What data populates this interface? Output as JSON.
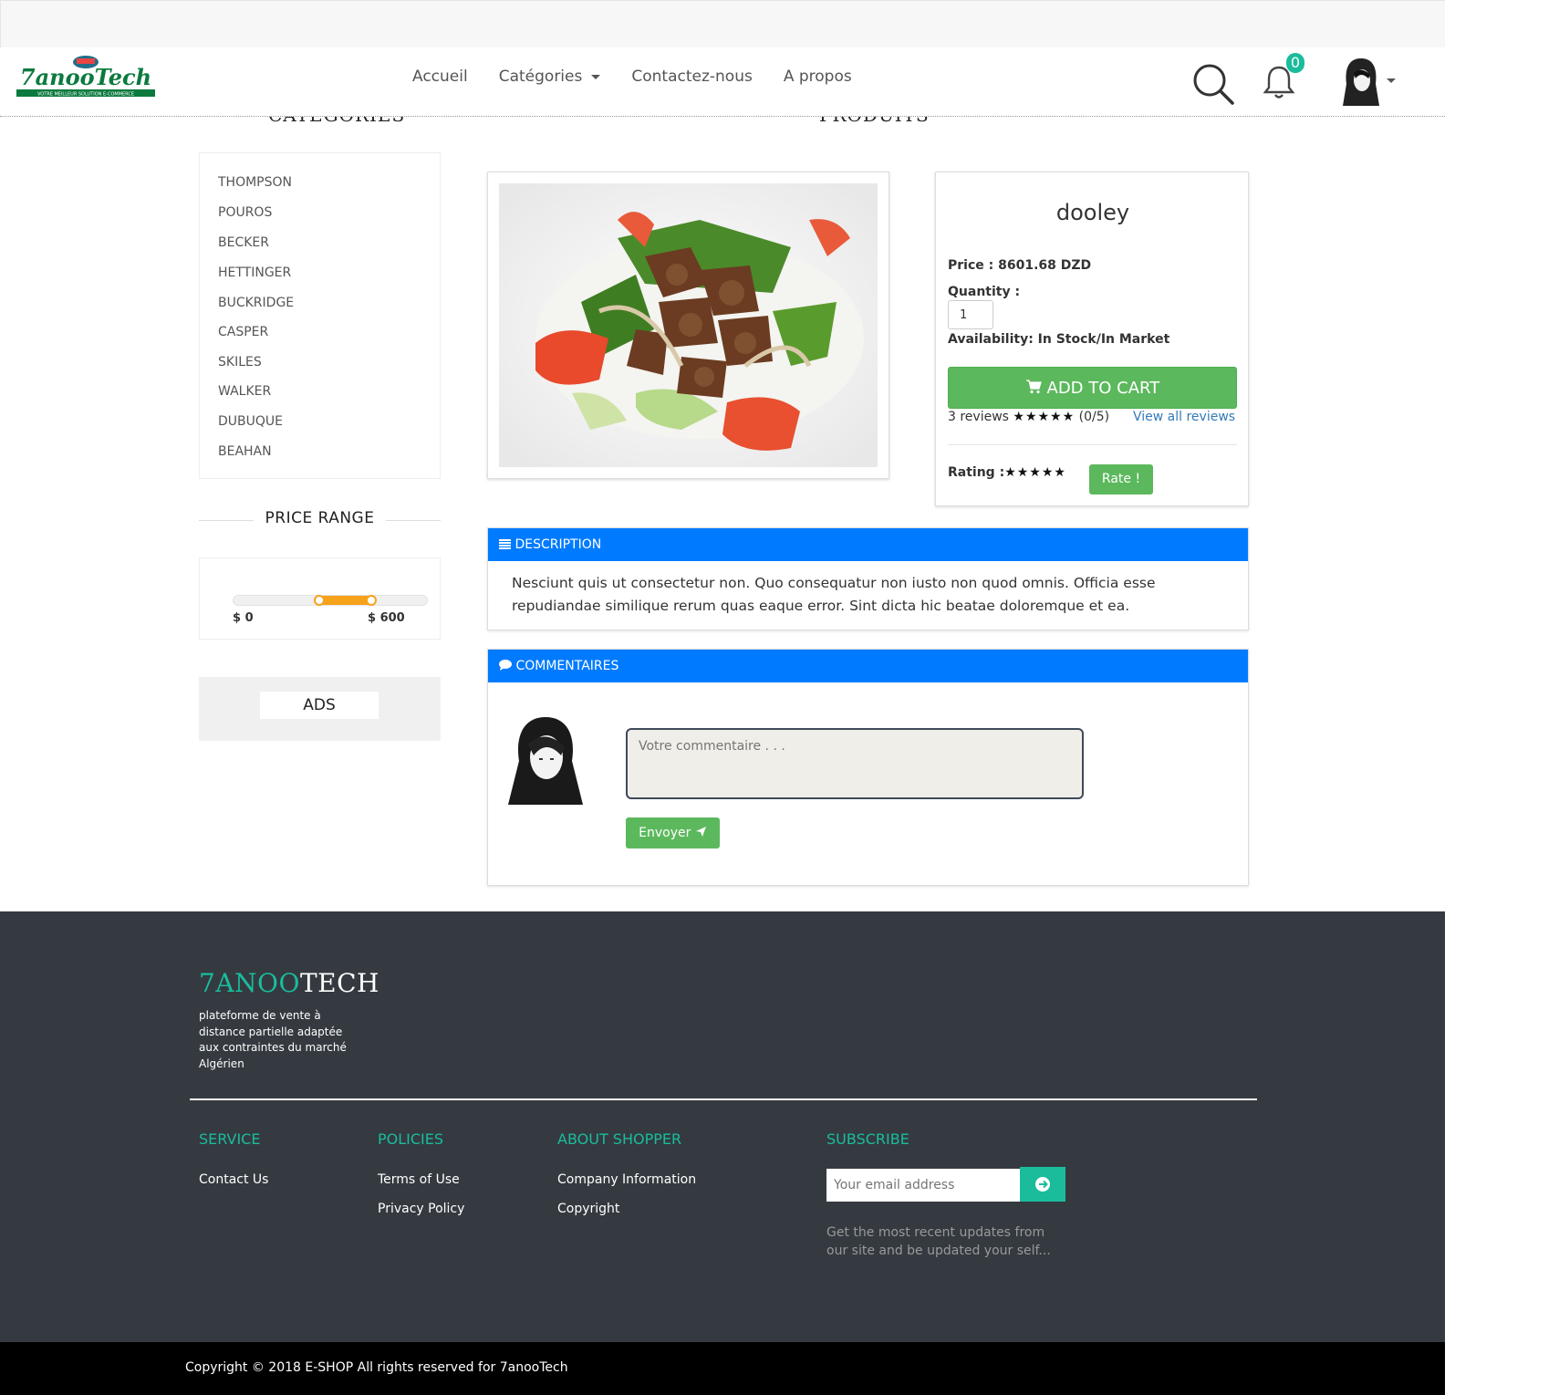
{
  "nav": {
    "brand": "7anooTech",
    "logo_tagline": "VOTRE MEILLEUR SOLUTION E-COMMERCE",
    "links": [
      "Accueil",
      "Catégories",
      "Contactez-nous",
      "A propos"
    ],
    "notification_count": "0"
  },
  "sections": {
    "categories_heading": "CATEGORIES",
    "products_heading": "PRODUITS"
  },
  "categories": [
    "THOMPSON",
    "POUROS",
    "BECKER",
    "HETTINGER",
    "BUCKRIDGE",
    "CASPER",
    "SKILES",
    "WALKER",
    "DUBUQUE",
    "BEAHAN"
  ],
  "price_range": {
    "title": "PRICE RANGE",
    "min_label": "$ 0",
    "max_label": "$ 600"
  },
  "ads": {
    "label": "ADS"
  },
  "product": {
    "name": "dooley",
    "price_text": "Price : 8601.68 DZD",
    "quantity_label": "Quantity :",
    "quantity_value": "1",
    "availability_text": "Availability: In Stock/In Market",
    "add_to_cart": "ADD TO CART",
    "reviews_count": "3 reviews",
    "stars": "★★★★★",
    "score": "(0/5)",
    "view_all": "View all reviews",
    "rating_label": "Rating :",
    "rate_button": "Rate !"
  },
  "description": {
    "title": "DESCRIPTION",
    "text": "Nesciunt quis ut consectetur non. Quo consequatur non iusto non quod omnis. Officia esse repudiandae similique rerum quas eaque error. Sint dicta hic beatae doloremque et ea."
  },
  "comments": {
    "title": "COMMENTAIRES",
    "placeholder": "Votre commentaire . . .",
    "send_button": "Envoyer"
  },
  "footer": {
    "brand_part1": "7ANOO",
    "brand_part2": "TECH",
    "tagline": "plateforme de vente à distance partielle adaptée aux contraintes du marché Algérien",
    "service_title": "SERVICE",
    "service_links": [
      "Contact Us"
    ],
    "policies_title": "POLICIES",
    "policies_links": [
      "Terms of Use",
      "Privacy Policy"
    ],
    "about_title": "ABOUT SHOPPER",
    "about_links": [
      "Company Information",
      "Copyright"
    ],
    "subscribe_title": "SUBSCRIBE",
    "email_placeholder": "Your email address",
    "subscribe_text": "Get the most recent updates from our site and be updated your self...",
    "copyright": "Copyright © 2018 E-SHOP All rights reserved for 7anooTech"
  },
  "colors": {
    "primary": "#007bff",
    "success": "#5cb85c",
    "teal": "#1abc9c",
    "footer_bg": "#343a40",
    "slider": "#f7a21b"
  }
}
